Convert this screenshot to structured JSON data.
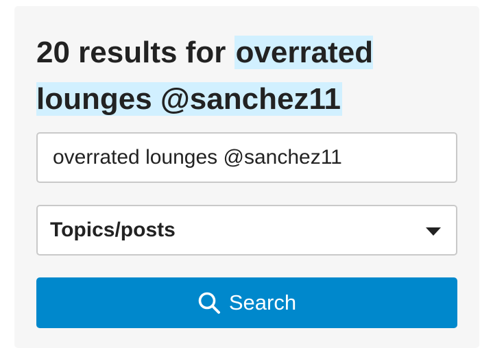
{
  "results": {
    "prefix": "20 results for ",
    "term": "overrated lounges @sanchez11"
  },
  "search": {
    "value": "overrated lounges @sanchez11",
    "placeholder": ""
  },
  "type_select": {
    "selected": "Topics/posts",
    "icon": "caret-down-icon"
  },
  "search_button": {
    "label": "Search",
    "icon": "search-icon",
    "color": "#0088cc"
  },
  "colors": {
    "highlight": "#d1f0ff",
    "panel_background": "#f6f6f6",
    "text": "#222222"
  }
}
